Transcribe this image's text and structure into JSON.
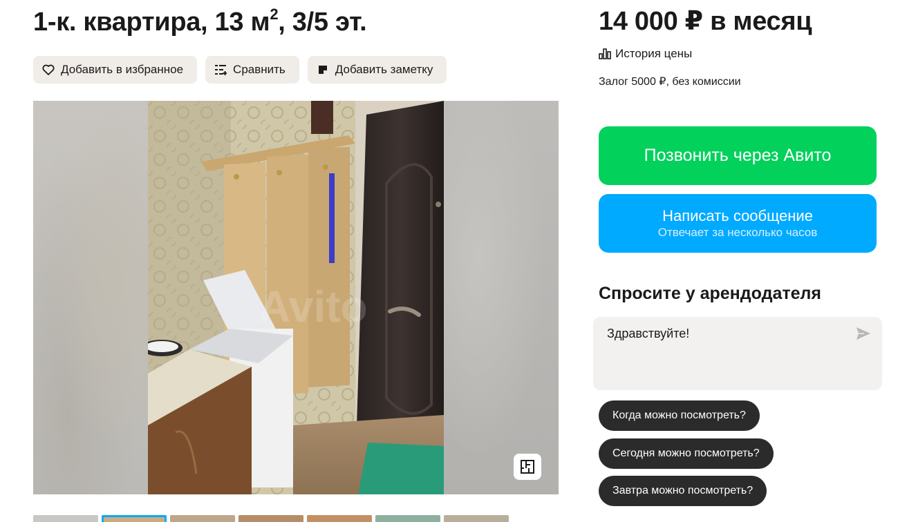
{
  "listing": {
    "title_main": "1-к. квартира, 13 м",
    "title_sup": "2",
    "title_rest": ", 3/5 эт."
  },
  "actions": {
    "favorite_label": "Добавить в избранное",
    "compare_label": "Сравнить",
    "note_label": "Добавить заметку"
  },
  "gallery": {
    "watermark": "Avito"
  },
  "pricing": {
    "price": "14 000 ₽ в месяц",
    "history_label": "История цены",
    "deposit": "Залог 5000 ₽, без комиссии"
  },
  "contact": {
    "call_label": "Позвонить через Авито",
    "message_label": "Написать сообщение",
    "message_sub": "Отвечает за несколько часов"
  },
  "ask": {
    "title": "Спросите у арендодателя",
    "message_value": "Здравствуйте!",
    "quick_questions": [
      "Когда можно посмотреть?",
      "Сегодня можно посмотреть?",
      "Завтра можно посмотреть?"
    ]
  },
  "colors": {
    "call_green": "#02d15c",
    "message_blue": "#00aaff",
    "chip_dark": "#2b2b2b",
    "action_bg": "#f0ede8"
  },
  "icons": {
    "favorite": "heart-icon",
    "compare": "compare-icon",
    "note": "note-icon",
    "history": "chart-icon",
    "floorplan": "floorplan-icon",
    "send": "send-icon"
  }
}
